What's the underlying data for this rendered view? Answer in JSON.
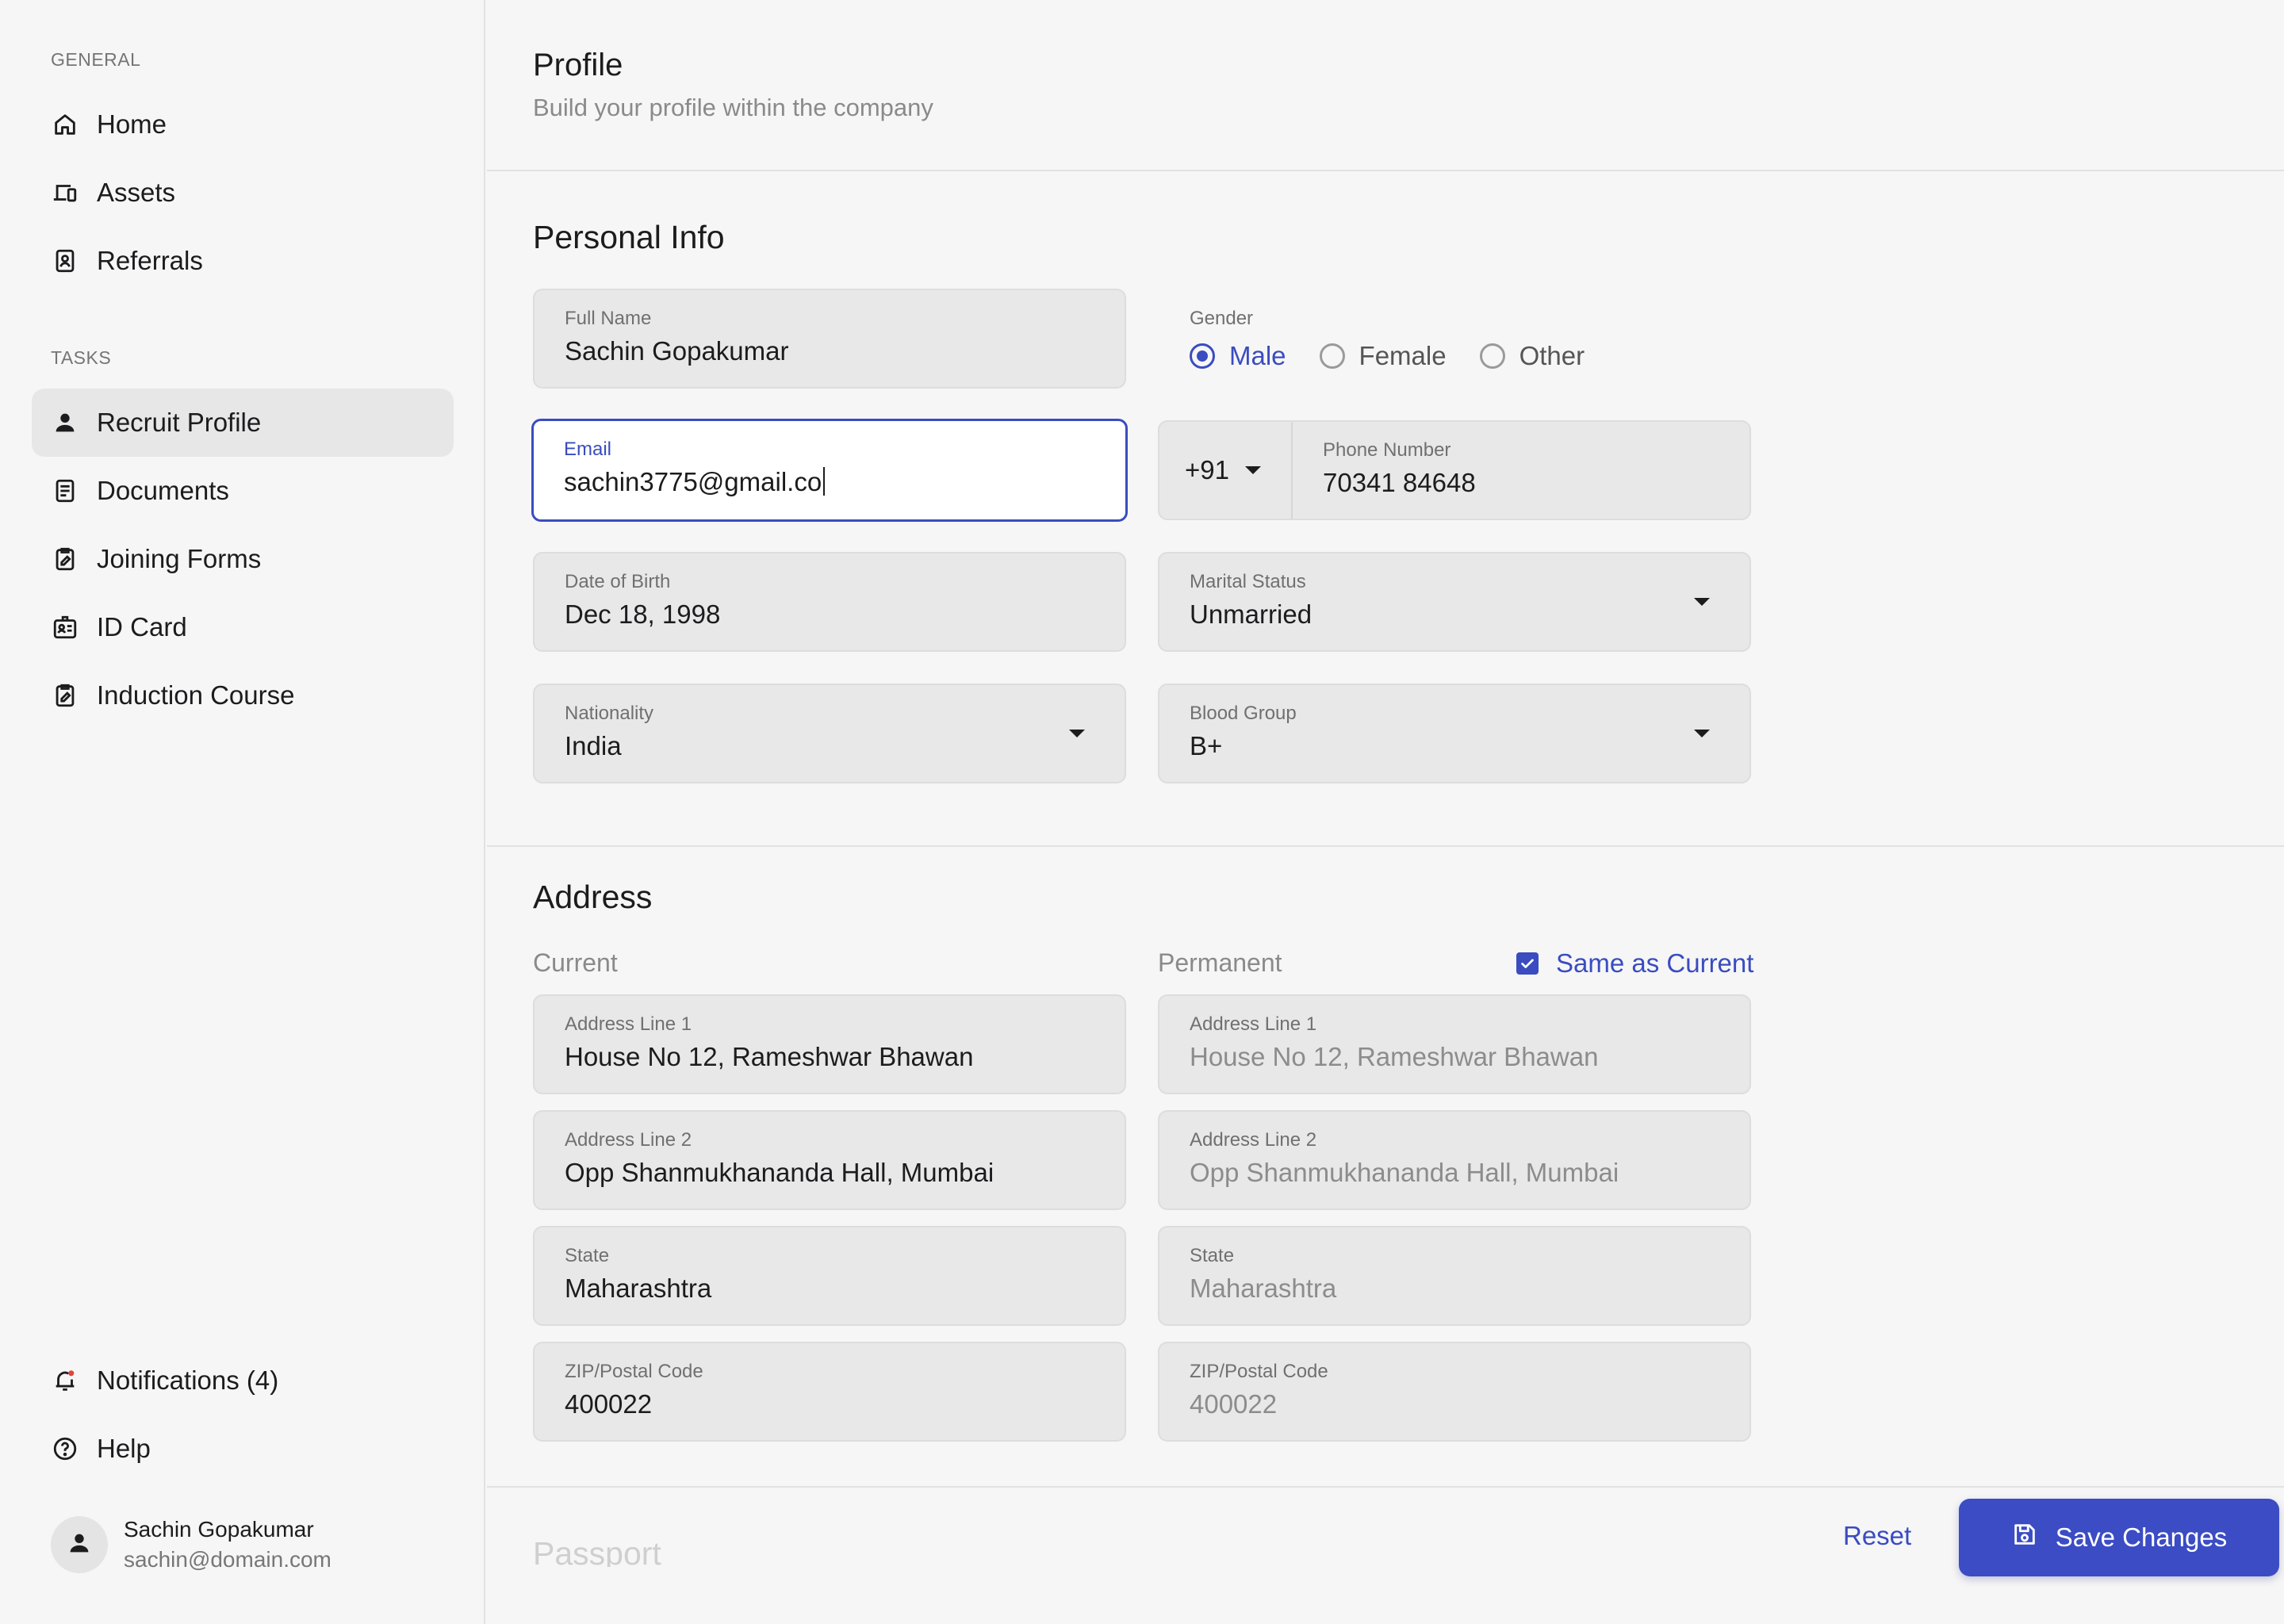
{
  "sidebar": {
    "general_label": "GENERAL",
    "general_items": [
      {
        "label": "Home",
        "icon": "home-icon"
      },
      {
        "label": "Assets",
        "icon": "devices-icon"
      },
      {
        "label": "Referrals",
        "icon": "contact-card-icon"
      }
    ],
    "tasks_label": "TASKS",
    "task_items": [
      {
        "label": "Recruit Profile",
        "icon": "person-icon",
        "active": true
      },
      {
        "label": "Documents",
        "icon": "document-icon"
      },
      {
        "label": "Joining Forms",
        "icon": "clipboard-edit-icon"
      },
      {
        "label": "ID Card",
        "icon": "id-badge-icon"
      },
      {
        "label": "Induction Course",
        "icon": "clipboard-edit-icon"
      }
    ],
    "bottom_items": [
      {
        "label": "Notifications (4)",
        "icon": "bell-icon"
      },
      {
        "label": "Help",
        "icon": "help-icon"
      }
    ],
    "user": {
      "name": "Sachin Gopakumar",
      "email": "sachin@domain.com"
    }
  },
  "header": {
    "title": "Profile",
    "subtitle": "Build your profile within the company"
  },
  "personal_info": {
    "title": "Personal Info",
    "full_name": {
      "label": "Full Name",
      "value": "Sachin Gopakumar"
    },
    "gender": {
      "label": "Gender",
      "options": [
        "Male",
        "Female",
        "Other"
      ],
      "selected": "Male"
    },
    "email": {
      "label": "Email",
      "value": "sachin3775@gmail.co"
    },
    "phone": {
      "country_code": "+91",
      "label": "Phone Number",
      "value": "70341 84648"
    },
    "dob": {
      "label": "Date of Birth",
      "value": "Dec 18, 1998"
    },
    "marital_status": {
      "label": "Marital Status",
      "value": "Unmarried"
    },
    "nationality": {
      "label": "Nationality",
      "value": "India"
    },
    "blood_group": {
      "label": "Blood Group",
      "value": "B+"
    }
  },
  "address": {
    "title": "Address",
    "current_label": "Current",
    "permanent_label": "Permanent",
    "same_as_current_label": "Same as Current",
    "same_as_current_checked": true,
    "current": {
      "line1": {
        "label": "Address Line 1",
        "value": "House No 12, Rameshwar Bhawan"
      },
      "line2": {
        "label": "Address Line 2",
        "value": "Opp Shanmukhananda Hall, Mumbai"
      },
      "state": {
        "label": "State",
        "value": "Maharashtra"
      },
      "zip": {
        "label": "ZIP/Postal Code",
        "value": "400022"
      }
    },
    "permanent": {
      "line1": {
        "label": "Address Line 1",
        "value": "House No 12, Rameshwar Bhawan"
      },
      "line2": {
        "label": "Address Line 2",
        "value": "Opp Shanmukhananda Hall, Mumbai"
      },
      "state": {
        "label": "State",
        "value": "Maharashtra"
      },
      "zip": {
        "label": "ZIP/Postal Code",
        "value": "400022"
      }
    }
  },
  "passport": {
    "title": "Passport"
  },
  "actions": {
    "reset_label": "Reset",
    "save_label": "Save Changes"
  },
  "colors": {
    "accent": "#3a4cc0",
    "background": "#f6f6f6",
    "field_bg": "#e8e8e8"
  }
}
